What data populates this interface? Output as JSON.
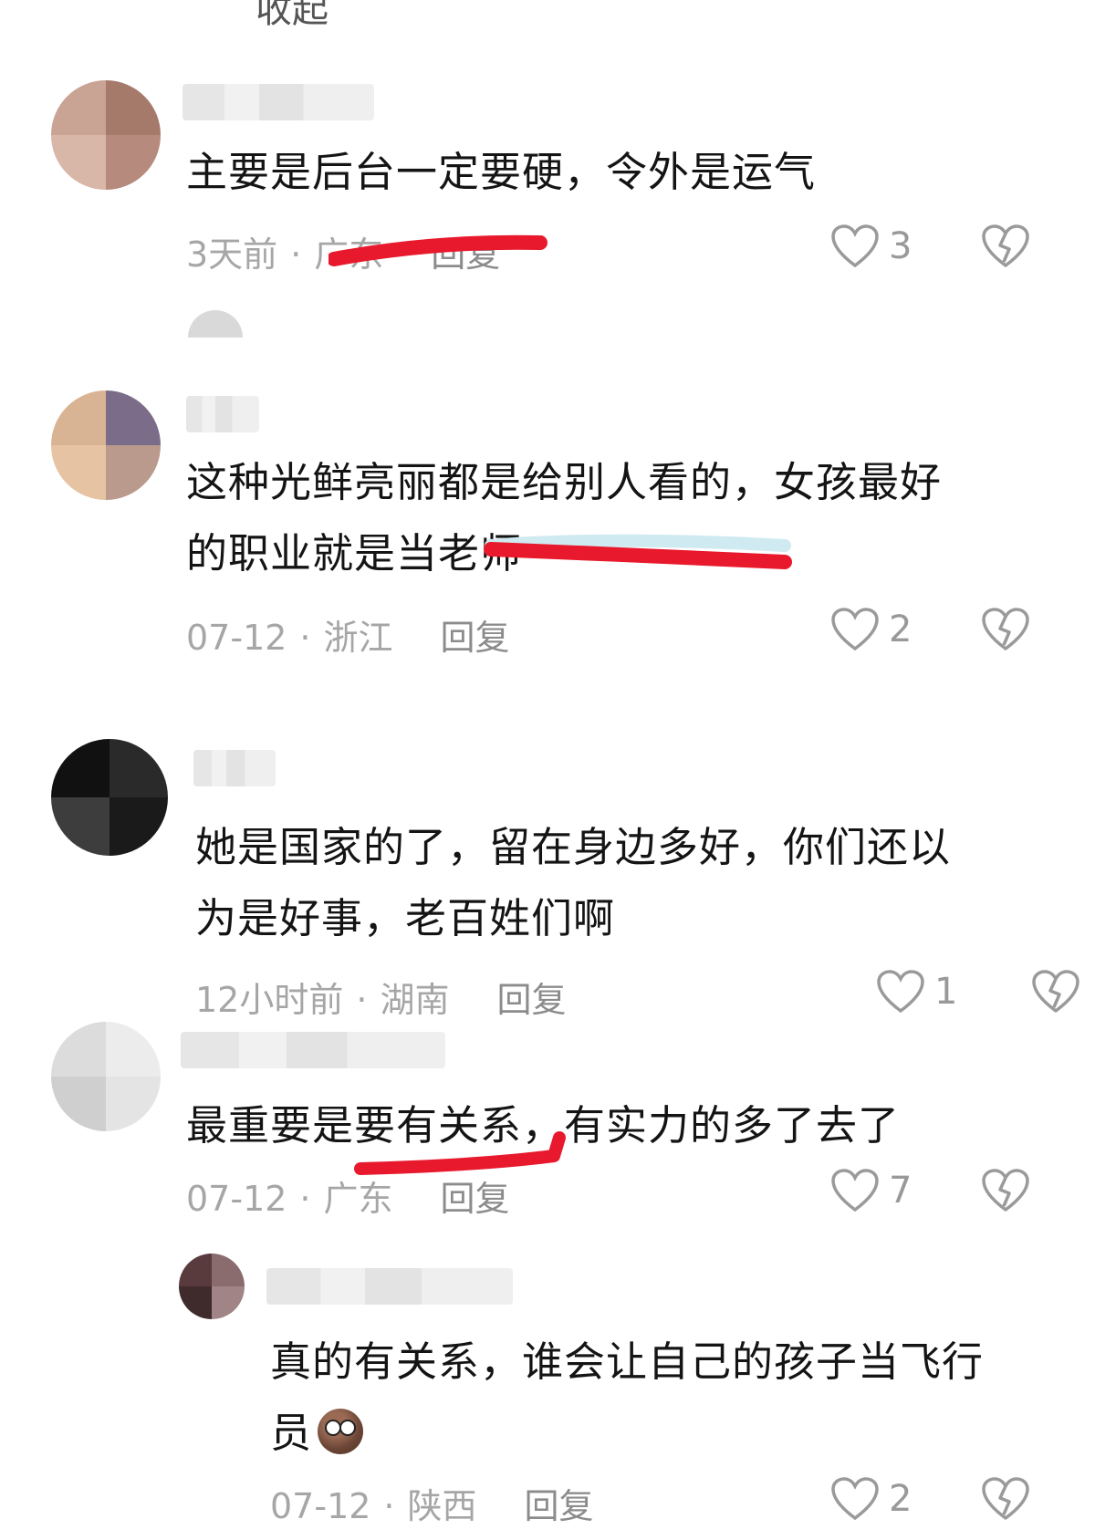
{
  "top_cut_text": "收起",
  "comments": [
    {
      "text_lines": [
        "主要是后台一定要硬，令外是运气"
      ],
      "time": "3天前",
      "location": "广东",
      "reply_label": "回复",
      "likes": "3",
      "avatar_colors": [
        "#c9a394",
        "#a57a6b",
        "#d8b6a8",
        "#b68a7c"
      ]
    },
    {
      "text_lines": [
        "这种光鲜亮丽都是给别人看的，女孩最好",
        "的职业就是当老师"
      ],
      "time": "07-12",
      "location": "浙江",
      "reply_label": "回复",
      "likes": "2",
      "avatar_colors": [
        "#d9b494",
        "#7b6d8a",
        "#e6c3a2",
        "#b99a8c"
      ]
    },
    {
      "text_lines": [
        "她是国家的了，留在身边多好，你们还以",
        "为是好事，老百姓们啊"
      ],
      "time": "12小时前",
      "location": "湖南",
      "reply_label": "回复",
      "likes": "1",
      "avatar_colors": [
        "#111111",
        "#2a2a2a",
        "#3d3d3d",
        "#1a1a1a"
      ]
    },
    {
      "text_lines": [
        "最重要是要有关系，有实力的多了去了"
      ],
      "time": "07-12",
      "location": "广东",
      "reply_label": "回复",
      "likes": "7",
      "avatar_colors": [
        "#dcdcdc",
        "#ececec",
        "#cfcfcf",
        "#e4e4e4"
      ]
    }
  ],
  "reply": {
    "text_lines": [
      "真的有关系，谁会让自己的孩子当飞行",
      "员"
    ],
    "time": "07-12",
    "location": "陕西",
    "reply_label": "回复",
    "likes": "2",
    "avatar_colors": [
      "#5a3b3d",
      "#8a6b6e",
      "#3f2a2c",
      "#a08486"
    ]
  }
}
